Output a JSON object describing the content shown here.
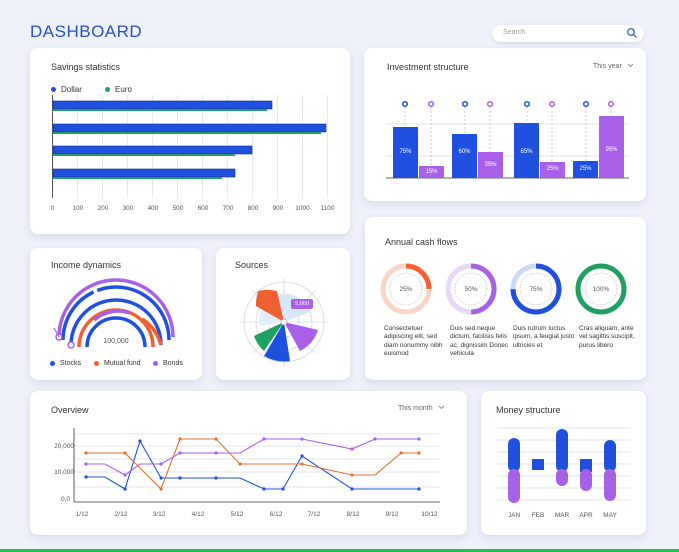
{
  "header": {
    "title": "DASHBOARD",
    "search_placeholder": "Search"
  },
  "colors": {
    "blue": "#2050e0",
    "purple": "#a860e8",
    "orange": "#f06030",
    "green": "#20a060"
  },
  "savings": {
    "title": "Savings statistics",
    "legend": [
      "Dollar",
      "Euro"
    ],
    "xticks": [
      "0",
      "100",
      "200",
      "300",
      "400",
      "500",
      "600",
      "700",
      "800",
      "900",
      "1000",
      "1100"
    ]
  },
  "investment": {
    "title": "Investment structure",
    "filter": "This year",
    "blue_labels": [
      "75%",
      "60%",
      "85%",
      "25%"
    ],
    "purple_labels": [
      "15%",
      "35%",
      "25%",
      "95%"
    ]
  },
  "income": {
    "title": "Income dynamics",
    "center_value": "100,000",
    "legend": [
      "Stocks",
      "Mutual fund",
      "Bonds"
    ]
  },
  "sources": {
    "title": "Sources",
    "badge": "5,000"
  },
  "cashflows": {
    "title": "Annual cash flows",
    "items": [
      {
        "pct": "25%",
        "text": "Consectetuer adipiscing elit, sed diam nonummy nibh euismod",
        "color": "#f06030"
      },
      {
        "pct": "50%",
        "text": "Duis sed neque dictum, facilisis felis ac, dignissim Donec vehicula",
        "color": "#a860e8"
      },
      {
        "pct": "75%",
        "text": "Duis rutrum luctus ipsum, a feugiat justo ultricies et",
        "color": "#2050e0"
      },
      {
        "pct": "100%",
        "text": "Cras aliquam, ante vel sagittis suscipit, purus libero",
        "color": "#20a060"
      }
    ]
  },
  "overview": {
    "title": "Overview",
    "filter": "This month",
    "yticks": [
      "20,000",
      "10,000",
      "0,0"
    ],
    "xticks": [
      "1/12",
      "2/12",
      "3/12",
      "4/12",
      "5/12",
      "6/12",
      "7/12",
      "8/12",
      "9/12",
      "10/12"
    ]
  },
  "money": {
    "title": "Money structure",
    "xticks": [
      "JAN",
      "FEB",
      "MAR",
      "APR",
      "MAY"
    ]
  },
  "chart_data": [
    {
      "type": "bar",
      "title": "Savings statistics",
      "orientation": "horizontal",
      "xlim": [
        0,
        1100
      ],
      "series": [
        {
          "name": "Dollar",
          "values": [
            880,
            1100,
            800,
            730
          ]
        },
        {
          "name": "Euro",
          "values": [
            860,
            1080,
            730,
            680
          ]
        }
      ]
    },
    {
      "type": "bar",
      "title": "Investment structure",
      "series": [
        {
          "values": [
            75,
            60,
            85,
            25
          ]
        },
        {
          "values": [
            15,
            35,
            25,
            95
          ]
        }
      ]
    },
    {
      "type": "line",
      "title": "Overview",
      "x": [
        "1/12",
        "2/12",
        "3/12",
        "4/12",
        "5/12",
        "6/12",
        "7/12",
        "8/12",
        "9/12",
        "10/12"
      ],
      "ylim": [
        0,
        25000
      ],
      "series": [
        {
          "color": "#2050e0",
          "values": [
            9000,
            9000,
            4000,
            22000,
            10000,
            10000,
            10000,
            4000,
            4000,
            4000,
            16000,
            4000,
            4000,
            4000,
            4000,
            4000,
            4000
          ]
        },
        {
          "color": "#e07030",
          "values": [
            18000,
            18000,
            18000,
            4000,
            22000,
            22000,
            15000,
            15000,
            15000,
            7000,
            7000,
            18000,
            18000,
            18000,
            18000,
            18000,
            18000
          ]
        },
        {
          "color": "#a860e8",
          "values": [
            14000,
            14000,
            9000,
            14000,
            14000,
            18000,
            18000,
            18000,
            22000,
            22000,
            22000,
            22000,
            22000,
            22000,
            22000,
            22000,
            22000
          ]
        }
      ]
    },
    {
      "type": "bar",
      "title": "Money structure",
      "categories": [
        "JAN",
        "FEB",
        "MAR",
        "APR",
        "MAY"
      ],
      "series": [
        {
          "color": "#2050e0",
          "values": [
            30,
            12,
            40,
            15,
            28
          ]
        },
        {
          "color": "#a860e8",
          "values": [
            30,
            0,
            15,
            18,
            27
          ]
        }
      ]
    }
  ]
}
